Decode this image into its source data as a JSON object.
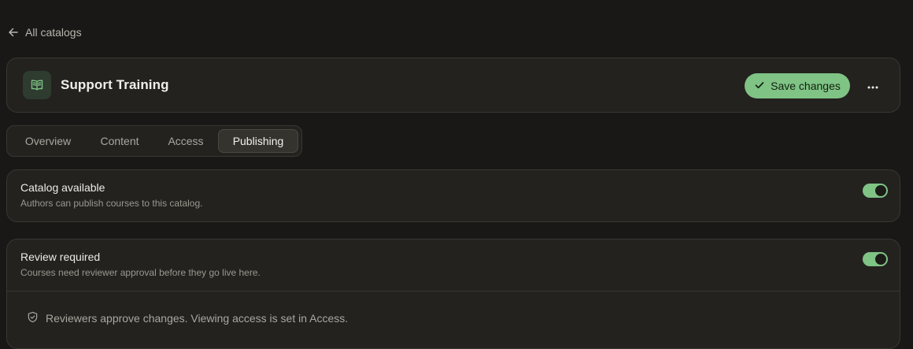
{
  "nav": {
    "back_label": "All catalogs"
  },
  "header": {
    "title": "Support Training",
    "save_label": "Save changes"
  },
  "tabs": [
    {
      "label": "Overview",
      "active": false
    },
    {
      "label": "Content",
      "active": false
    },
    {
      "label": "Access",
      "active": false
    },
    {
      "label": "Publishing",
      "active": true
    }
  ],
  "settings": [
    {
      "title": "Catalog available",
      "description": "Authors can publish courses to this catalog.",
      "enabled": true
    },
    {
      "title": "Review required",
      "description": "Courses need reviewer approval before they go live here.",
      "enabled": true,
      "note": "Reviewers approve changes. Viewing access is set in Access."
    }
  ],
  "colors": {
    "accent": "#7fc385",
    "background": "#191816",
    "card": "#23221f",
    "border": "#393732"
  },
  "icons": {
    "back": "arrow-left-icon",
    "catalog": "book-open-icon",
    "save": "check-icon",
    "more": "more-horizontal-icon",
    "note": "shield-check-icon"
  }
}
